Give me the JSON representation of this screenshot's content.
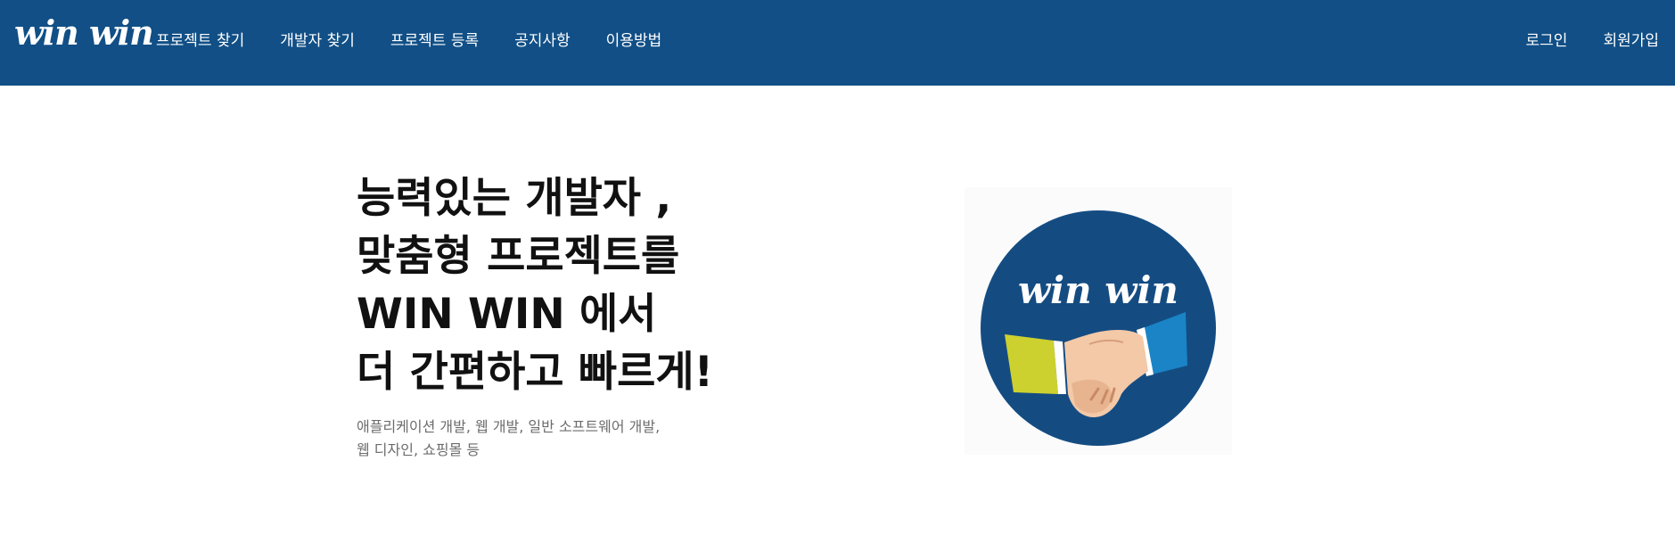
{
  "brand": {
    "logo_text": "win win"
  },
  "nav": {
    "left": [
      "프로젝트 찾기",
      "개발자 찾기",
      "프로젝트 등록",
      "공지사항",
      "이용방법"
    ],
    "right": [
      "로그인",
      "회원가입"
    ]
  },
  "hero": {
    "headline": [
      "능력있는 개발자 ,",
      "맞춤형 프로젝트를",
      "WIN WIN 에서",
      "더 간편하고 빠르게!"
    ],
    "subtext": [
      "애플리케이션 개발, 웹 개발, 일반 소프트웨어 개발,",
      "웹 디자인, 쇼핑몰 등"
    ]
  },
  "illustration": {
    "badge_text": "win win",
    "icon": "handshake-icon"
  },
  "colors": {
    "navbar": "#114f86",
    "badge_circle": "#144c82",
    "left_sleeve": "#cdd12f",
    "right_sleeve": "#1a84c6",
    "skin": "#f3c9a8"
  }
}
